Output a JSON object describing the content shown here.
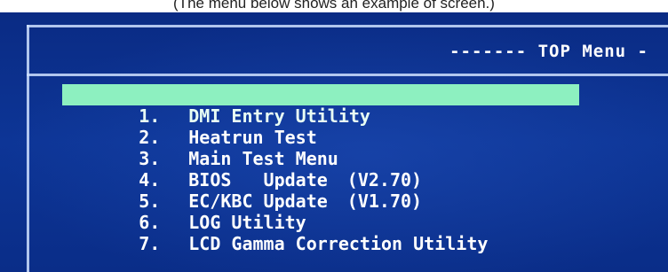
{
  "caption": "(The menu below shows an example of screen.)",
  "screen": {
    "title": "------- TOP Menu -",
    "menu_items": [
      {
        "number": "1.",
        "label": "DMI Entry Utility",
        "version": "",
        "selected": true
      },
      {
        "number": "2.",
        "label": "Heatrun Test",
        "version": "",
        "selected": false
      },
      {
        "number": "3.",
        "label": "Main Test Menu",
        "version": "",
        "selected": false
      },
      {
        "number": "4.",
        "label": "BIOS   Update",
        "version": "(V2.70)",
        "selected": false
      },
      {
        "number": "5.",
        "label": "EC/KBC Update",
        "version": "(V1.70)",
        "selected": false
      },
      {
        "number": "6.",
        "label": "LOG Utility",
        "version": "",
        "selected": false
      },
      {
        "number": "7.",
        "label": "LCD Gamma Correction Utility",
        "version": "",
        "selected": false
      }
    ],
    "colors": {
      "background": "#0b2f8c",
      "highlight": "#8df0c0",
      "text": "#ffffff"
    }
  }
}
